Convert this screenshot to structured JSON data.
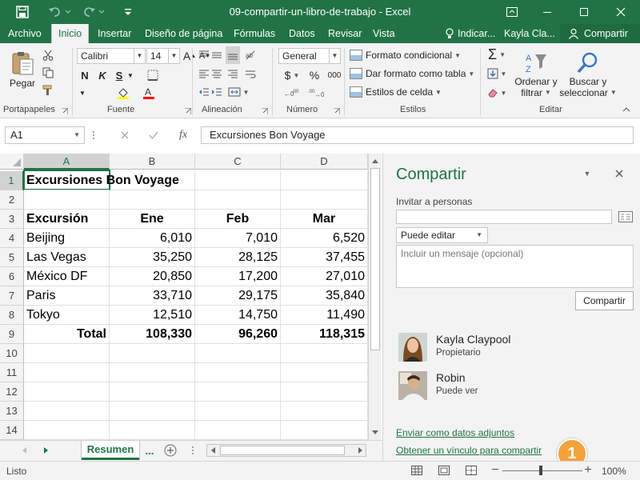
{
  "window": {
    "title": "09-compartir-un-libro-de-trabajo  -  Excel"
  },
  "tabs": {
    "file": "Archivo",
    "home": "Inicio",
    "insert": "Insertar",
    "layout": "Diseño de página",
    "formulas": "Fórmulas",
    "data": "Datos",
    "review": "Revisar",
    "view": "Vista",
    "tell_me": "Indicar...",
    "user": "Kayla Cla...",
    "share": "Compartir"
  },
  "ribbon": {
    "clipboard": {
      "paste": "Pegar",
      "label": "Portapapeles"
    },
    "font": {
      "name": "Calibri",
      "size": "14",
      "bold": "N",
      "italic": "K",
      "underline": "S",
      "label": "Fuente"
    },
    "alignment": {
      "label": "Alineación"
    },
    "number": {
      "format": "General",
      "currency": "$",
      "percent": "%",
      "comma": "000",
      "label": "Número"
    },
    "styles": {
      "conditional": "Formato condicional",
      "table": "Dar formato como tabla",
      "cell": "Estilos de celda",
      "label": "Estilos"
    },
    "editing": {
      "sort": "Ordenar y filtrar",
      "sort_l1": "Ordenar y",
      "sort_l2": "filtrar",
      "find_l1": "Buscar y",
      "find_l2": "seleccionar",
      "label": "Editar"
    }
  },
  "formula_bar": {
    "name_box": "A1",
    "fx": "fx",
    "content": "Excursiones Bon Voyage"
  },
  "sheet": {
    "columns": [
      "A",
      "B",
      "C",
      "D"
    ],
    "rows": [
      "1",
      "2",
      "3",
      "4",
      "5",
      "6",
      "7",
      "8",
      "9",
      "10",
      "11",
      "12",
      "13",
      "14"
    ],
    "title": "Excursiones Bon Voyage",
    "headers": [
      "Excursión",
      "Ene",
      "Feb",
      "Mar"
    ],
    "data": [
      [
        "Beijing",
        "6,010",
        "7,010",
        "6,520"
      ],
      [
        "Las Vegas",
        "35,250",
        "28,125",
        "37,455"
      ],
      [
        "México DF",
        "20,850",
        "17,200",
        "27,010"
      ],
      [
        "Paris",
        "33,710",
        "29,175",
        "35,840"
      ],
      [
        "Tokyo",
        "12,510",
        "14,750",
        "11,490"
      ]
    ],
    "total": [
      "Total",
      "108,330",
      "96,260",
      "118,315"
    ],
    "tab_name": "Resumen",
    "tab_more": "..."
  },
  "share_pane": {
    "title": "Compartir",
    "invite_label": "Invitar a personas",
    "permission": "Puede editar",
    "message_placeholder": "Incluir un mensaje (opcional)",
    "share_button": "Compartir",
    "people": [
      {
        "name": "Kayla Claypool",
        "role": "Propietario"
      },
      {
        "name": "Robin",
        "role": "Puede ver"
      }
    ],
    "send_attachment": "Enviar como datos adjuntos",
    "get_link": "Obtener un vínculo para compartir"
  },
  "callout": "1",
  "status": {
    "ready": "Listo",
    "zoom": "100%"
  },
  "colors": {
    "accent": "#217346",
    "callout": "#f4a23a"
  }
}
